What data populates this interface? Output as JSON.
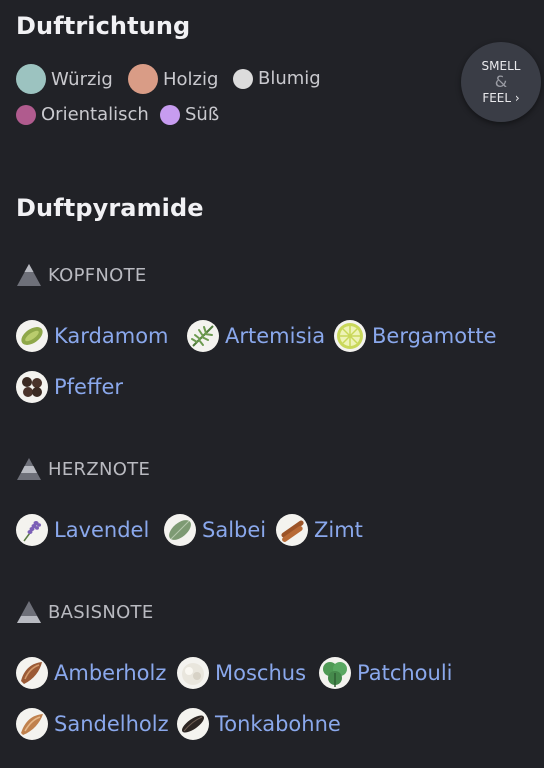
{
  "scent_direction": {
    "title": "Duftrichtung",
    "items": [
      {
        "label": "Würzig",
        "color": "#9cc3c0"
      },
      {
        "label": "Holzig",
        "color": "#d99c86"
      },
      {
        "label": "Blumig",
        "color": "#dcdcdc"
      },
      {
        "label": "Orientalisch",
        "color": "#b05b8e"
      },
      {
        "label": "Süß",
        "color": "#c79cf0"
      }
    ]
  },
  "smell_feel": {
    "line1": "SMELL",
    "amp": "&",
    "line2": "FEEL ›"
  },
  "pyramid": {
    "title": "Duftpyramide",
    "notes": [
      {
        "heading": "KOPFNOTE",
        "ingredients": [
          {
            "label": "Kardamom",
            "icon": "cardamom-icon"
          },
          {
            "label": "Artemisia",
            "icon": "artemisia-icon"
          },
          {
            "label": "Bergamotte",
            "icon": "bergamot-icon"
          },
          {
            "label": "Pfeffer",
            "icon": "pepper-icon"
          }
        ]
      },
      {
        "heading": "HERZNOTE",
        "ingredients": [
          {
            "label": "Lavendel",
            "icon": "lavender-icon"
          },
          {
            "label": "Salbei",
            "icon": "sage-icon"
          },
          {
            "label": "Zimt",
            "icon": "cinnamon-icon"
          }
        ]
      },
      {
        "heading": "BASISNOTE",
        "ingredients": [
          {
            "label": "Amberholz",
            "icon": "amberwood-icon"
          },
          {
            "label": "Moschus",
            "icon": "musk-icon"
          },
          {
            "label": "Patchouli",
            "icon": "patchouli-icon"
          },
          {
            "label": "Sandelholz",
            "icon": "sandalwood-icon"
          },
          {
            "label": "Tonkabohne",
            "icon": "tonka-bean-icon"
          }
        ]
      }
    ]
  }
}
